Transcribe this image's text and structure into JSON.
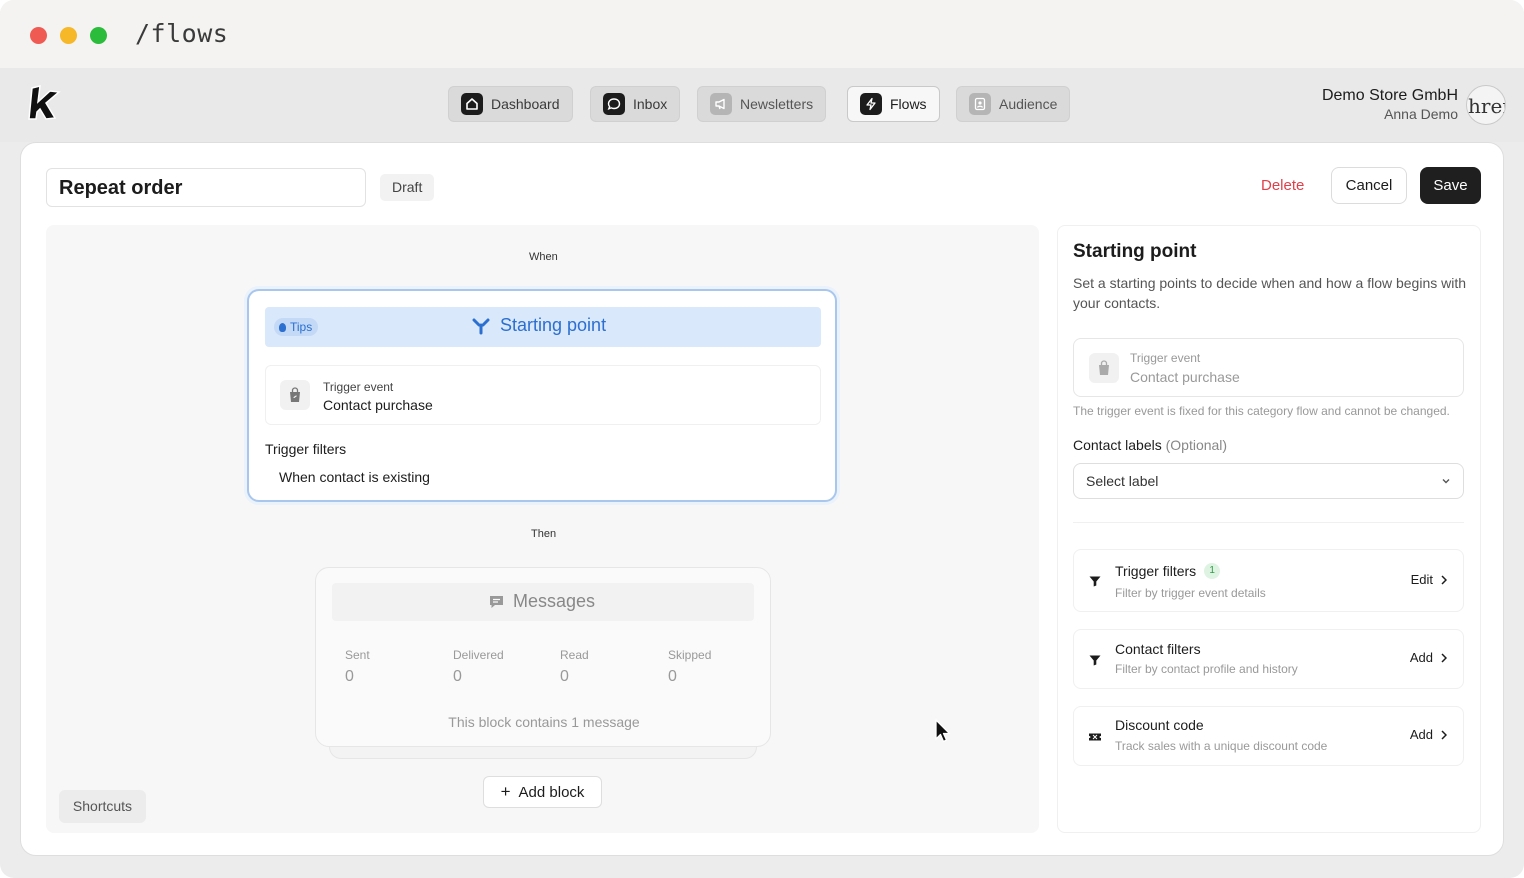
{
  "browser": {
    "url": "/flows"
  },
  "nav": {
    "items": [
      {
        "label": "Dashboard",
        "icon": "home-icon"
      },
      {
        "label": "Inbox",
        "icon": "chat-icon"
      },
      {
        "label": "Newsletters",
        "icon": "megaphone-icon"
      },
      {
        "label": "Flows",
        "icon": "lightning-icon"
      },
      {
        "label": "Audience",
        "icon": "contacts-icon"
      }
    ],
    "active": "Flows"
  },
  "account": {
    "org": "Demo Store GmbH",
    "user": "Anna Demo",
    "avatar_text": "hren"
  },
  "flow": {
    "name": "Repeat order",
    "status": "Draft"
  },
  "actions": {
    "delete": "Delete",
    "cancel": "Cancel",
    "save": "Save"
  },
  "canvas": {
    "when_label": "When",
    "then_label": "Then",
    "start": {
      "tips": "Tips",
      "title": "Starting point",
      "trigger_small": "Trigger event",
      "trigger_value": "Contact purchase",
      "filters_title": "Trigger filters",
      "filter_row": "When contact is existing"
    },
    "messages": {
      "title": "Messages",
      "stats": [
        {
          "label": "Sent",
          "value": "0"
        },
        {
          "label": "Delivered",
          "value": "0"
        },
        {
          "label": "Read",
          "value": "0"
        },
        {
          "label": "Skipped",
          "value": "0"
        }
      ],
      "footer": "This block contains 1 message"
    },
    "add_block": "Add block",
    "shortcuts": "Shortcuts"
  },
  "panel": {
    "title": "Starting point",
    "description": "Set a starting points to decide when and how a flow begins with your contacts.",
    "trigger_small": "Trigger event",
    "trigger_value": "Contact purchase",
    "trigger_note": "The trigger event is fixed for this category flow and cannot be changed.",
    "contact_labels": "Contact labels",
    "optional": "(Optional)",
    "select_placeholder": "Select label",
    "options": [
      {
        "title": "Trigger filters",
        "count": "1",
        "desc": "Filter by trigger event details",
        "action": "Edit"
      },
      {
        "title": "Contact filters",
        "desc": "Filter by contact profile and history",
        "action": "Add"
      },
      {
        "title": "Discount code",
        "desc": "Track sales with a unique discount code",
        "action": "Add"
      }
    ]
  },
  "colors": {
    "accent_blue": "#2b6fd1",
    "delete_red": "#e0404a",
    "save_bg": "#1f1f1f"
  }
}
